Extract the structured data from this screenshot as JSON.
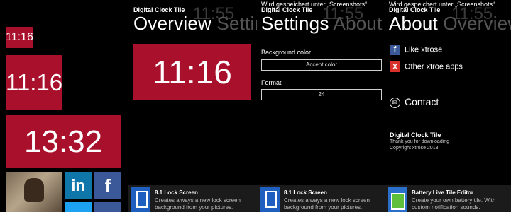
{
  "tiles": {
    "small_time": "11:16",
    "medium_time": "11:16",
    "wide_time": "13:32",
    "linkedin_label": "in",
    "facebook_label": "f"
  },
  "panel1": {
    "app_title": "Digital Clock Tile",
    "ghost_time": "11:55",
    "pivot_active": "Overview",
    "pivot_next": "Settings",
    "preview_time": "11:16",
    "store": {
      "title": "8.1 Lock Screen",
      "desc": "Creates always a new lock screen background from your pictures."
    }
  },
  "panel2": {
    "notice": "Wird gespeichert unter „Screenshots“...",
    "app_title": "Digital Clock Tile",
    "ghost_time": "11:55",
    "pivot_active": "Settings",
    "pivot_next": "About",
    "background_label": "Background color",
    "background_value": "Accent color",
    "format_label": "Format",
    "format_value": "24",
    "store": {
      "title": "8.1 Lock Screen",
      "desc": "Creates always a new lock screen background from your pictures."
    }
  },
  "panel3": {
    "notice": "Wird gespeichert unter „Screenshots“...",
    "app_title": "Digital Clock Tile",
    "ghost_time": "11:55",
    "pivot_active": "About",
    "pivot_next": "Overview",
    "like_label": "Like xtrose",
    "other_apps_label": "Other xtroe apps",
    "contact_label": "Contact",
    "info_title": "Digital Clock Tile",
    "info_thanks": "Thank you for downloading",
    "info_copyright": "Copyright xtrose 2013",
    "store": {
      "title": "Battery Live Tile Editor",
      "desc": "Create your own battery tile. With custom notification sounds."
    }
  },
  "colors": {
    "accent": "#a9102b",
    "facebook": "#3b5998",
    "linkedin": "#0e76a8",
    "other": "#d9302c"
  },
  "icons": {
    "facebook": "facebook-icon",
    "other": "x-icon",
    "contact": "mail-icon",
    "store_lock": "lockscreen-app-icon",
    "store_battery": "battery-app-icon"
  }
}
